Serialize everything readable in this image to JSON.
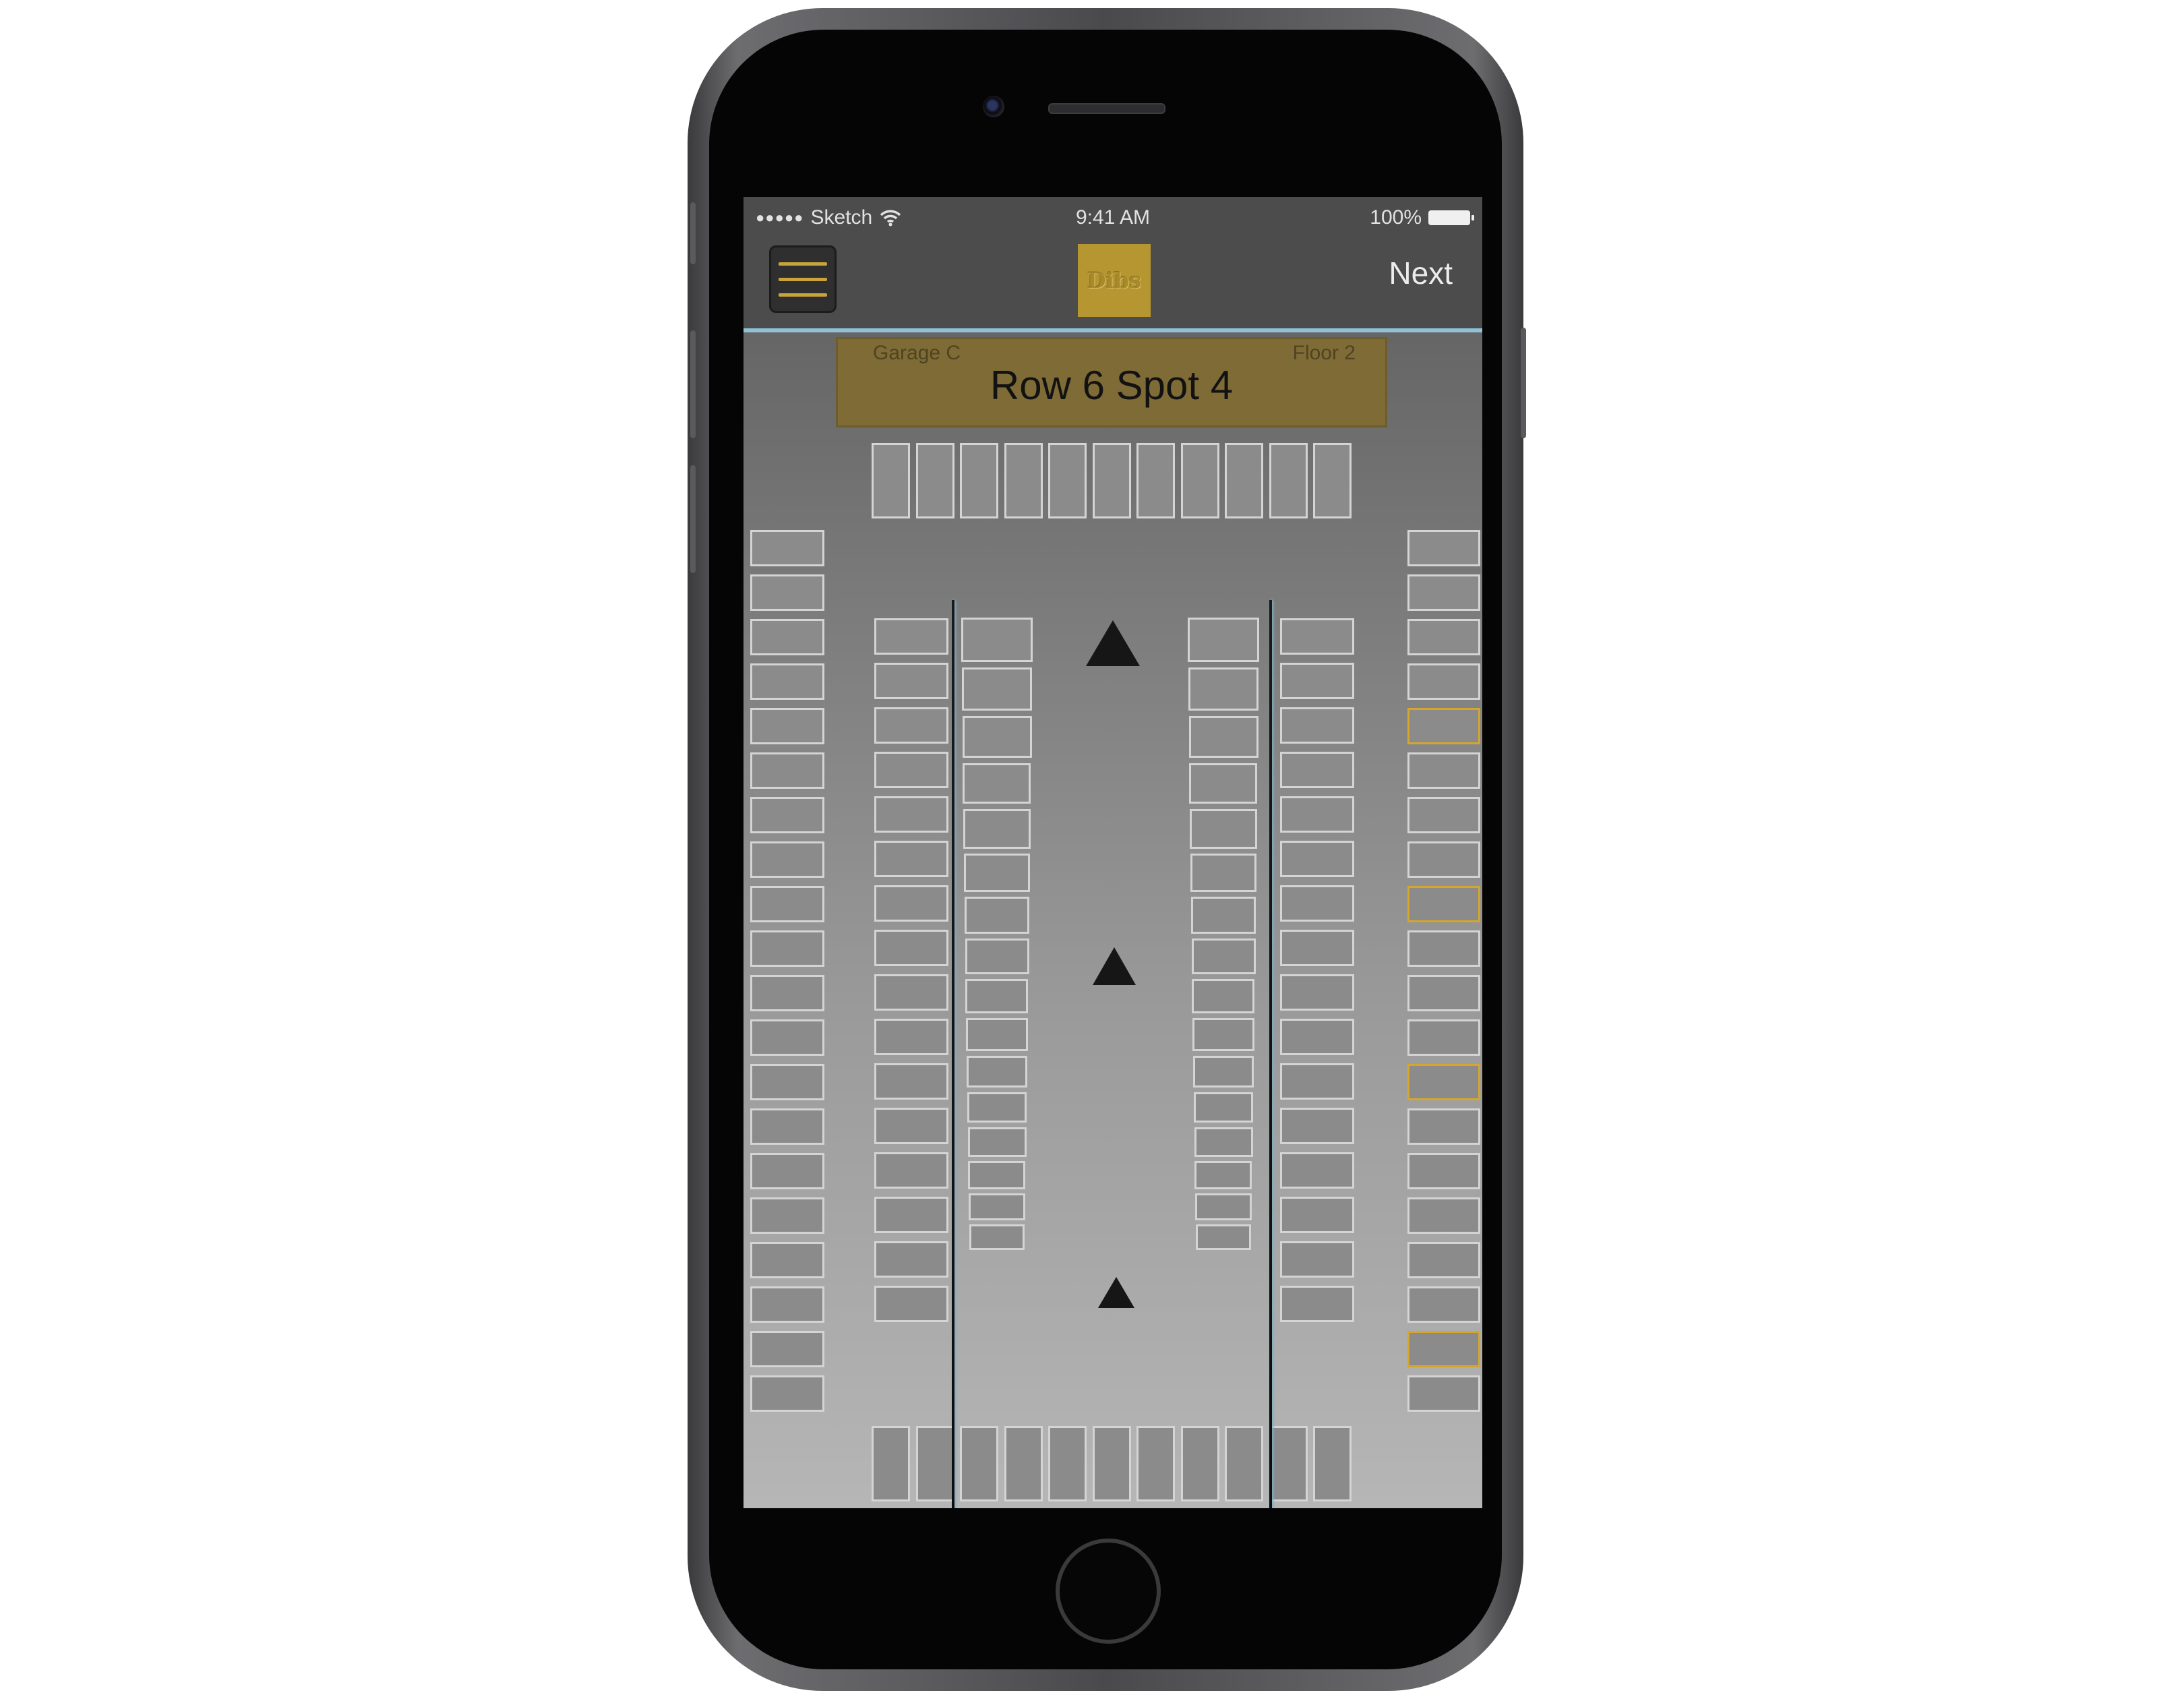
{
  "status_bar": {
    "signal_dots": "●●●●●",
    "carrier": "Sketch",
    "time": "9:41 AM",
    "battery": "100%"
  },
  "nav": {
    "logo_text": "Dibs",
    "next_label": "Next",
    "accent_color": "#b69630",
    "divider_color": "#8fc2d6"
  },
  "banner": {
    "garage": "Garage C",
    "floor": "Floor 2",
    "title": "Row 6 Spot 4"
  },
  "lot": {
    "reserved_color": "#d4a72c",
    "top_row_count": 11,
    "bottom_row_count": 11,
    "left_column_count": 20,
    "right_column_count": 20,
    "right_column_reserved_indices": [
      4,
      8,
      12,
      18
    ],
    "inner_left_column_count": 16,
    "inner_right_column_count": 16,
    "center_left_column_count": 16,
    "center_right_column_count": 16,
    "direction_arrows": 3
  }
}
